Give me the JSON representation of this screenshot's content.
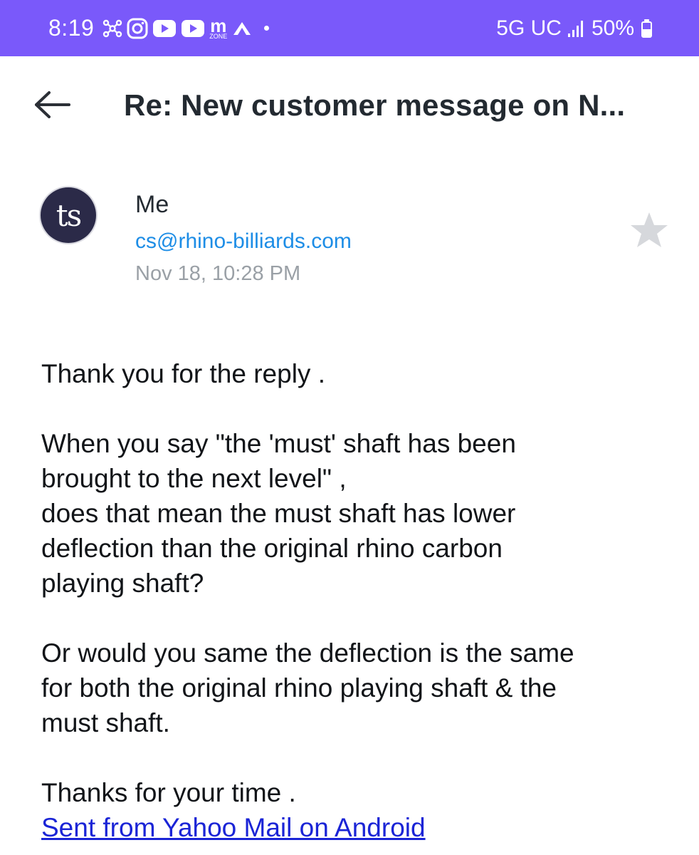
{
  "status_bar": {
    "time": "8:19",
    "mzone_label": "m",
    "mzone_sub": "ZONE",
    "network": "5G UC",
    "battery": "50%",
    "battery_level": 0.5,
    "background_color": "#7a59fa",
    "icons": [
      "network-hub-icon",
      "instagram-icon",
      "youtube-icon",
      "youtube-icon",
      "mzone-icon",
      "drive-icon",
      "dot-icon",
      "signal-icon",
      "battery-icon"
    ]
  },
  "header": {
    "back_icon": "arrow-left-icon",
    "subject": "Re: New customer message on N..."
  },
  "sender": {
    "avatar_initials": "ts",
    "name": "Me",
    "email": "cs@rhino-billiards.com",
    "date": "Nov 18, 10:28 PM",
    "star_icon": "star-icon",
    "email_color": "#1d8de6"
  },
  "body": {
    "p1": "Thank you for the reply .",
    "p2": "When you say \"the 'must' shaft has been\nbrought to the next level\" ,\ndoes that mean the must shaft has lower\ndeflection than the original rhino carbon\nplaying shaft?",
    "p3": "Or would you same the deflection is the same\nfor both the original rhino playing shaft & the\nmust shaft.",
    "p4": "Thanks for your time .",
    "signature": "Sent from Yahoo Mail on Android",
    "signature_color": "#1a24d6"
  }
}
